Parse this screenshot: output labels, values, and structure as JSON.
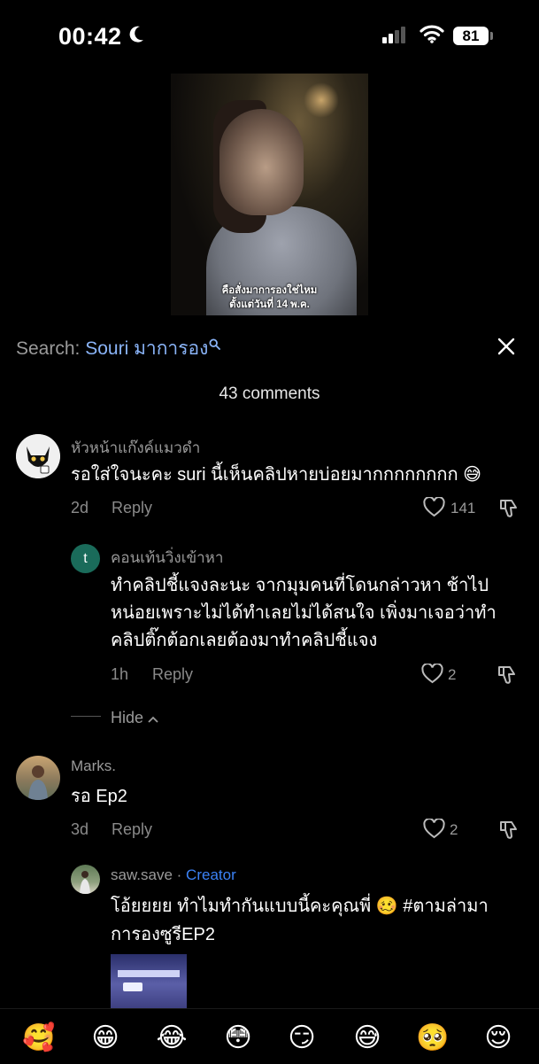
{
  "status": {
    "time": "00:42",
    "battery": "81"
  },
  "video": {
    "caption_line1": "คือสั่งมาการองใช่ไหม",
    "caption_line2": "ตั้งแต่วันที่ 14 พ.ค."
  },
  "search": {
    "label": "Search:",
    "term": "Souri มาการอง"
  },
  "comments_count": "43 comments",
  "comments": [
    {
      "user": "หัวหน้าแก๊งค์แมวดำ",
      "text": "รอใส่ใจนะคะ suri นี้เห็นคลิปหายบ่อยมากกกกกกกก 😅",
      "age": "2d",
      "reply": "Reply",
      "likes": "141"
    },
    {
      "user": "คอนเท้นวิ่งเข้าหา",
      "avatar_letter": "t",
      "text_line1": "ทำคลิปชี้แจงละนะ จากมุมคนที่โดนกล่าวหา ช้าไป",
      "text_line2": "หน่อยเพราะไม่ได้ทำเลยไม่ได้สนใจ เพิ่งมาเจอว่าทำ",
      "text_line3": "คลิปติ๊กต้อกเลยต้องมาทำคลิปชี้แจง",
      "age": "1h",
      "reply": "Reply",
      "likes": "2"
    },
    {
      "user": "Marks.",
      "text": "รอ Ep2",
      "age": "3d",
      "reply": "Reply",
      "likes": "2"
    },
    {
      "user": "saw.save",
      "sep": " · ",
      "creator": "Creator",
      "text_line1": "โอ้ยยยย ทำไมทำกันแบบนี้คะคุณพี่ 🥴 #ตามล่ามา",
      "text_line2": "การองซูรีEP2"
    }
  ],
  "hide_label": "Hide",
  "emoji_bar": [
    "🥰",
    "😁",
    "😂",
    "😳",
    "😏",
    "😅",
    "🥺",
    "😌"
  ],
  "colors": {
    "creator": "#3b82f6",
    "search_term": "#8ab4f8",
    "background": "#000000"
  }
}
